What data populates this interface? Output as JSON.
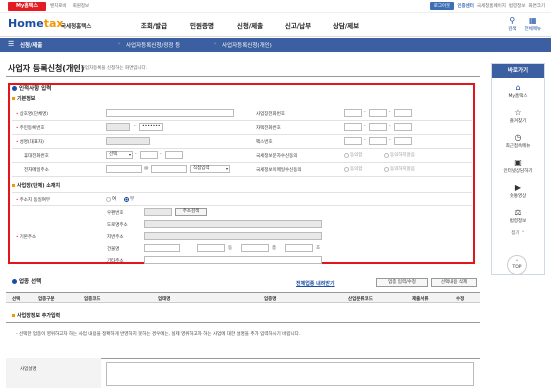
{
  "util": {
    "myhome": "My홈택스",
    "links": [
      "밴치로비",
      "회원정보"
    ],
    "login": "로그아웃",
    "join": "인증센터",
    "right_links": [
      "국세청홈페이지",
      "법령정보",
      "화면크기"
    ]
  },
  "gnb": {
    "logo": "HomeTax",
    "logo_sub": "국세청홈택스",
    "menu": [
      "조회/발급",
      "민원증명",
      "신청/제출",
      "신고/납부",
      "상담/제보"
    ],
    "search_label": "검색",
    "allmenu_label": "전체메뉴"
  },
  "location": {
    "crumbs": [
      "신청/제출",
      "사업자등록신청/정정 등",
      "사업자등록신청(개인)"
    ]
  },
  "page": {
    "title": "사업자 등록신청(개인)",
    "desc": "개인 사업자등록을 신청하는 화면입니다."
  },
  "section_personal": {
    "heading": "인적사항 입력",
    "sub_basic": "기본정보",
    "labels": {
      "trade_name": "상호명(단체명)",
      "rrn": "주민등록번호",
      "name": "성명(대표자)",
      "mobile": "휴대전화번호",
      "email": "전자메일주소",
      "biz_phone": "사업장전화번호",
      "home_phone": "자택전화번호",
      "fax": "팩스번호",
      "sms_agree": "국세정보문자수신동의",
      "email_agree": "국세정보이메일수신동의"
    },
    "rrn_mask": "•••••••",
    "mobile_select": "선택",
    "email_at": "@",
    "email_select": "직접입력",
    "agree": "동의함",
    "disagree": "동의하지않음"
  },
  "section_address": {
    "sub": "사업장(단체) 소재지",
    "own_label": "주소지 동일여부",
    "yes": "여",
    "no": "부",
    "addr_label": "기본주소",
    "fields": {
      "zip": "우편번호",
      "road": "도로명주소",
      "jibun": "지번주소",
      "building": "건물명",
      "dong": "동",
      "floor": "층",
      "ho": "호",
      "etc": "기타주소"
    },
    "search_btn": "주소검색"
  },
  "section_business": {
    "heading": "업종 선택",
    "link": "전체업종 내려받기",
    "btn_edit": "업종 입력/수정",
    "btn_delete": "선택내용 삭제",
    "columns": [
      "선택",
      "업종구분",
      "업종코드",
      "업태명",
      "업종명",
      "산업분류코드",
      "제출서류",
      "수정"
    ],
    "sub_extra": "사업장정보 추가입력",
    "note": "- 선택한 업종이 영위하고자 하는 사업 내용을 정확하게 반영하지 못하는 경우에는, 실제 영위하고자 하는 사업에 대한 설명을 추가 입력하시기 바랍니다.",
    "desc_label": "사업설명"
  },
  "quick": {
    "title": "바로가기",
    "items": [
      "My홈택스",
      "즐겨찾기",
      "최근접속메뉴",
      "인터넷상담하기",
      "숏통영상",
      "법령정보"
    ],
    "close": "접기",
    "top": "TOP"
  }
}
